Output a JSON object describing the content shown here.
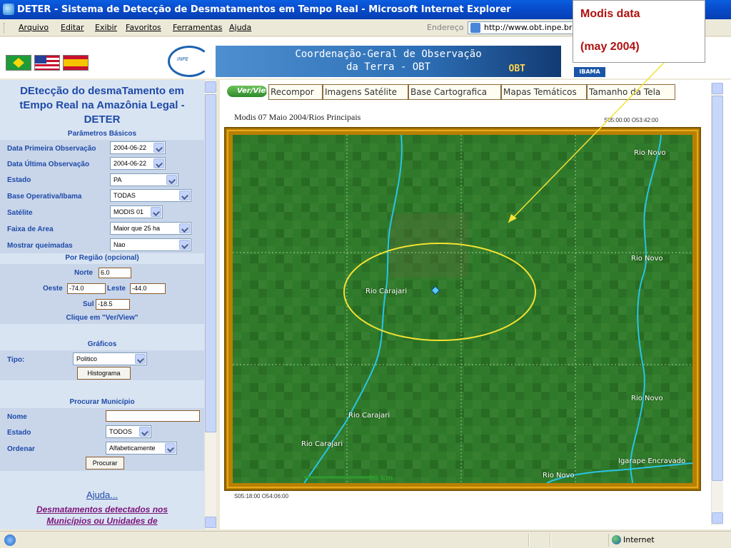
{
  "window": {
    "title": "DETER - Sistema de Detecção de Desmatamentos em Tempo Real - Microsoft Internet Explorer"
  },
  "menu": {
    "items": [
      "Arquivo",
      "Editar",
      "Exibir",
      "Favoritos",
      "Ferramentas",
      "Ajuda"
    ],
    "address_label": "Endereço",
    "address_value": "http://www.obt.inpe.br"
  },
  "banner": {
    "obt_line1": "Coordenação-Geral de Observação",
    "obt_line2": "da Terra - OBT",
    "obt_mark": "OBT",
    "inpe_mark": "INPE",
    "ibama_mark": "IBAMA"
  },
  "callout": {
    "line1": "Modis data",
    "line2": "(may 2004)"
  },
  "left": {
    "title_line1": "DEtecção do desmaTamento em",
    "title_line2": "tEmpo Real na Amazônia Legal -",
    "title_line3": "DETER",
    "section_basic": "Parâmetros Básicos",
    "fields": {
      "first_obs_label": "Data Primeira Observação",
      "first_obs_value": "2004-06-22",
      "last_obs_label": "Data Última Observação",
      "last_obs_value": "2004-06-22",
      "estado_label": "Estado",
      "estado_value": "PA",
      "base_label": "Base Operativa/Ibama",
      "base_value": "TODAS",
      "satelite_label": "Satélite",
      "satelite_value": "MODIS 01",
      "faixa_label": "Faixa de Area",
      "faixa_value": "Maior que 25 ha",
      "queimadas_label": "Mostrar queimadas",
      "queimadas_value": "Nao"
    },
    "section_region": "Por Região (opcional)",
    "region": {
      "norte_label": "Norte",
      "norte_value": "6.0",
      "oeste_label": "Oeste",
      "oeste_value": "-74.0",
      "leste_label": "Leste",
      "leste_value": "-44.0",
      "sul_label": "Sul",
      "sul_value": "-18.5",
      "hint": "Clique em \"Ver/View\""
    },
    "section_graphs": "Gráficos",
    "graphs": {
      "tipo_label": "Tipo:",
      "tipo_value": "Politico",
      "button": "Histograma"
    },
    "section_search": "Procurar Município",
    "search": {
      "nome_label": "Nome",
      "nome_value": "",
      "estado_label": "Estado",
      "estado_value": "TODOS",
      "ordenar_label": "Ordenar",
      "ordenar_value": "Alfabeticamente",
      "button": "Procurar"
    },
    "help_link": "Ajuda...",
    "desm_link_line1": "Desmatamentos detectados nos",
    "desm_link_line2": "Municípios ou Unidades de"
  },
  "tabs": {
    "view": "Ver/View",
    "items": [
      "Recompor",
      "Imagens Satélite",
      "Base Cartografica",
      "Mapas Temáticos",
      "Tamanho da Tela"
    ]
  },
  "map": {
    "title": "Modis 07 Maio 2004/Rios Principais",
    "coord_top_right": "S05:00:00 O53:42:00",
    "coord_bottom_left": "S05:18:00 O54:06:00",
    "scale_label": "10 km",
    "labels": [
      {
        "name": "Rio Novo",
        "key": "rio_novo_1"
      },
      {
        "name": "Rio Novo",
        "key": "rio_novo_2"
      },
      {
        "name": "Rio Carajari",
        "key": "rio_carajari_1"
      },
      {
        "name": "Rio Novo",
        "key": "rio_novo_3"
      },
      {
        "name": "Rio Carajari",
        "key": "rio_carajari_2"
      },
      {
        "name": "Rio Carajari",
        "key": "rio_carajari_3"
      },
      {
        "name": "Igarape Encravado",
        "key": "igarape_encravado"
      },
      {
        "name": "Rio Novo",
        "key": "rio_novo_4"
      }
    ]
  },
  "status": {
    "zone": "Internet"
  },
  "colors": {
    "title_bar": "#0849c7",
    "panel_blue": "#1e4aa8",
    "callout_red": "#b01010",
    "forest_green": "#2f7a2a",
    "river_cyan": "#29c4e8",
    "highlight_yellow": "#f2e232",
    "frame_gold": "#b88000"
  }
}
